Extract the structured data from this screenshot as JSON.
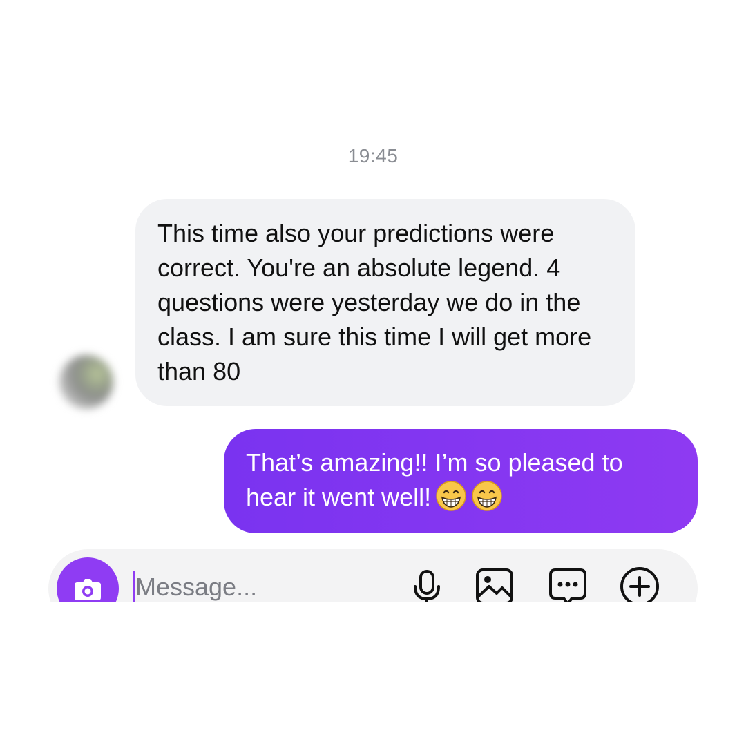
{
  "thread": {
    "timestamp": "19:45"
  },
  "messages": [
    {
      "direction": "incoming",
      "text": "This time also your predictions were correct. You're an absolute legend. 4 questions were yesterday we do in the class. I am sure this time I will get more than 80"
    },
    {
      "direction": "outgoing",
      "text": "That’s amazing!! I’m so pleased to hear it went well!",
      "emojis": [
        "grinning-face-with-smiling-eyes",
        "grinning-face-with-smiling-eyes"
      ]
    }
  ],
  "composer": {
    "placeholder": "Message...",
    "value": "",
    "icons": [
      "camera-icon",
      "microphone-icon",
      "gallery-icon",
      "sticker-chat-icon",
      "plus-circle-icon"
    ]
  },
  "colors": {
    "accent": "#8f3cf3",
    "incoming_bubble": "#f1f2f4",
    "outgoing_bubble": "#8533f1",
    "timestamp_text": "#8a8d93"
  }
}
